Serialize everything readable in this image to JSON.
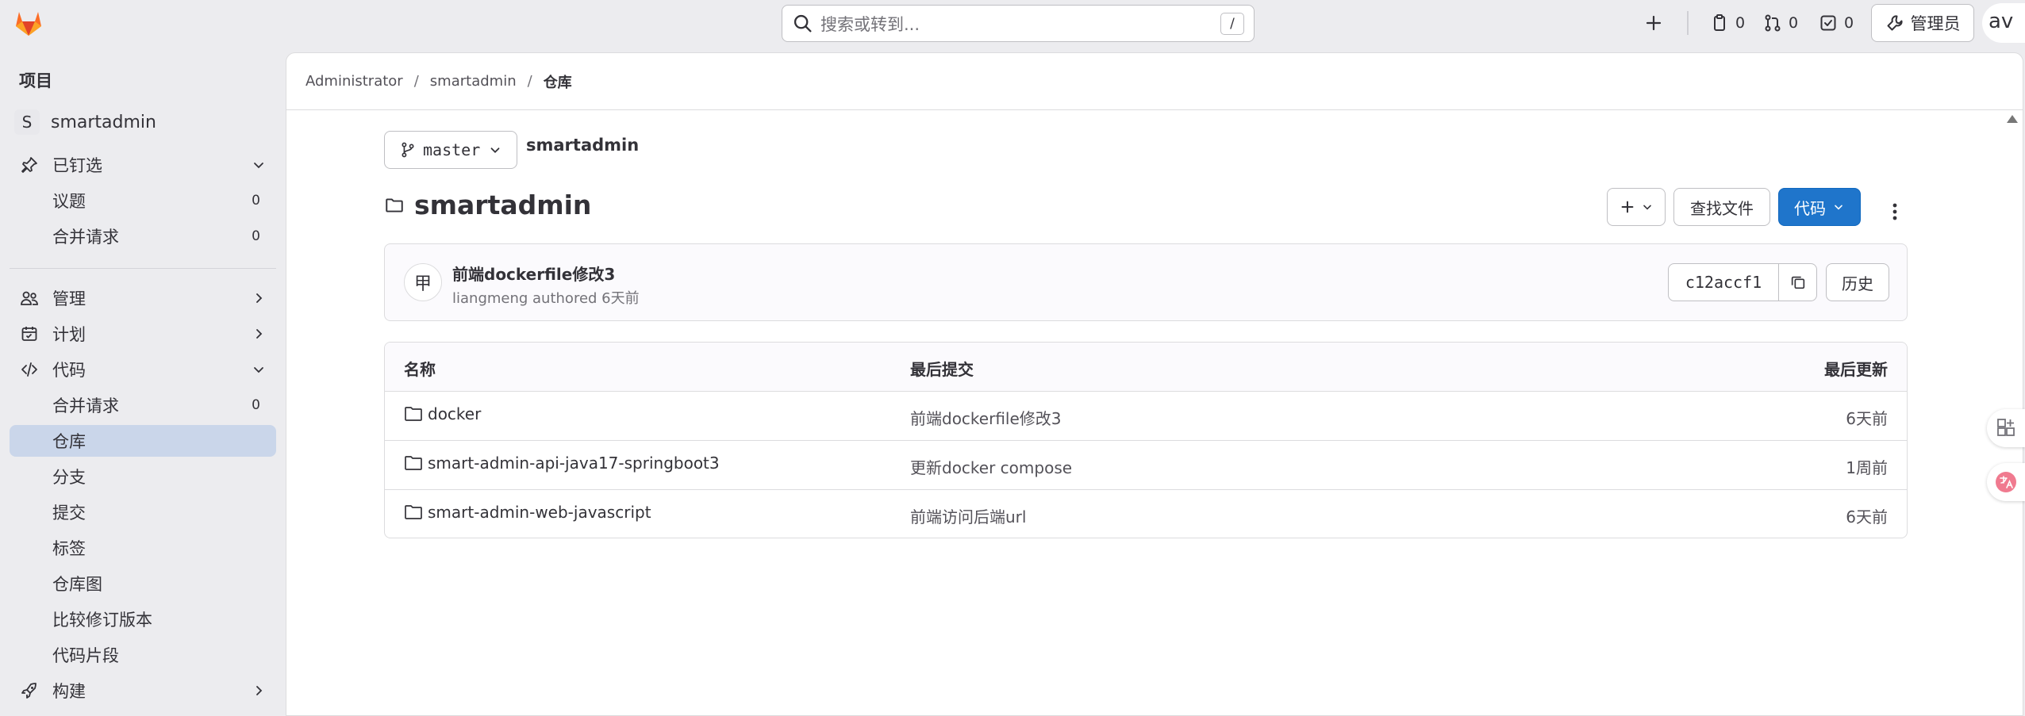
{
  "search": {
    "placeholder": "搜索或转到...",
    "shortcut": "/"
  },
  "topbar": {
    "issues_count": "0",
    "mr_count": "0",
    "todo_count": "0",
    "admin_label": "管理员",
    "avatar_alt": "av"
  },
  "sidebar": {
    "heading": "项目",
    "project": {
      "initial": "S",
      "name": "smartadmin"
    },
    "pinned": {
      "label": "已钉选",
      "items": [
        {
          "label": "议题",
          "count": "0"
        },
        {
          "label": "合并请求",
          "count": "0"
        }
      ]
    },
    "manage_label": "管理",
    "plan_label": "计划",
    "code": {
      "label": "代码",
      "items": [
        {
          "label": "合并请求",
          "count": "0"
        },
        {
          "label": "仓库"
        },
        {
          "label": "分支"
        },
        {
          "label": "提交"
        },
        {
          "label": "标签"
        },
        {
          "label": "仓库图"
        },
        {
          "label": "比较修订版本"
        },
        {
          "label": "代码片段"
        }
      ]
    },
    "build_label": "构建"
  },
  "breadcrumb": {
    "items": [
      "Administrator",
      "smartadmin",
      "仓库"
    ],
    "separator": "/"
  },
  "repo": {
    "branch": "master",
    "path_name": "smartadmin",
    "title": "smartadmin",
    "find_file_label": "查找文件",
    "code_label": "代码"
  },
  "last_commit": {
    "avatar_alt": "甲",
    "title": "前端dockerfile修改3",
    "author_line": "liangmeng authored 6天前",
    "sha": "c12accf1",
    "history_label": "历史"
  },
  "files": {
    "headers": {
      "name": "名称",
      "last_commit": "最后提交",
      "last_update": "最后更新"
    },
    "rows": [
      {
        "name": "docker",
        "commit": "前端dockerfile修改3",
        "updated": "6天前"
      },
      {
        "name": "smart-admin-api-java17-springboot3",
        "commit": "更新docker compose",
        "updated": "1周前"
      },
      {
        "name": "smart-admin-web-javascript",
        "commit": "前端访问后端url",
        "updated": "6天前"
      }
    ]
  },
  "colors": {
    "primary": "#1f75cb",
    "active_nav": "#cad6ea",
    "logo_orange": "#e24329"
  }
}
